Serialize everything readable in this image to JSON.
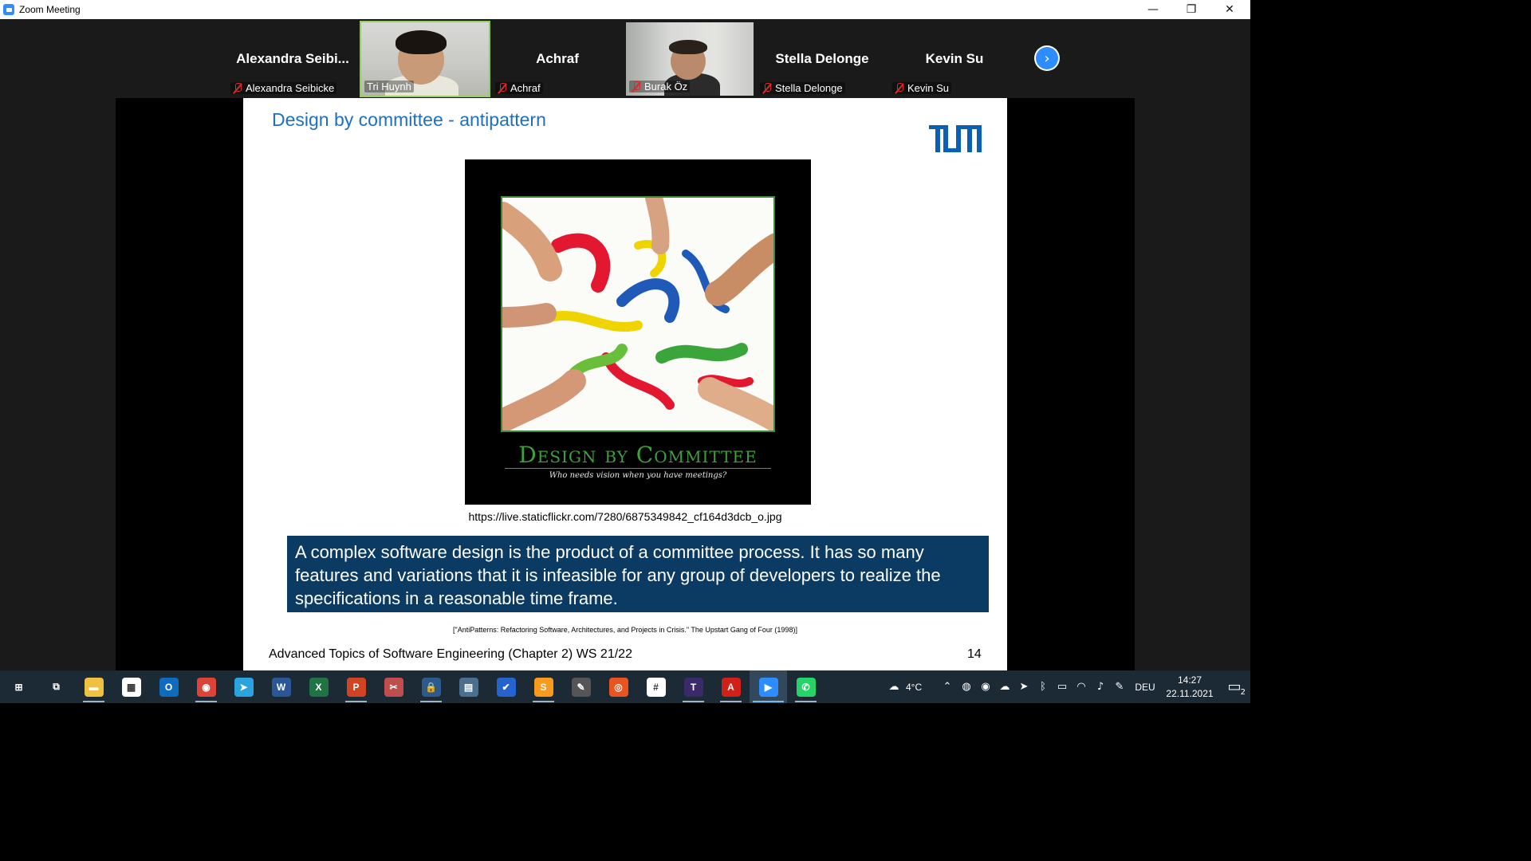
{
  "window": {
    "title": "Zoom Meeting",
    "minimize": "—",
    "restore": "❐",
    "close": "✕"
  },
  "participants": [
    {
      "big_name": "Alexandra  Seibi...",
      "label": "Alexandra Seibicke",
      "video": false,
      "muted": true
    },
    {
      "big_name": "",
      "label": "Tri Huynh",
      "video": true,
      "muted": false,
      "active_speaker": true
    },
    {
      "big_name": "Achraf",
      "label": "Achraf",
      "video": false,
      "muted": true
    },
    {
      "big_name": "",
      "label": "Burak Öz",
      "video": true,
      "muted": true
    },
    {
      "big_name": "Stella Delonge",
      "label": "Stella Delonge",
      "video": false,
      "muted": true
    },
    {
      "big_name": "Kevin Su",
      "label": "Kevin Su",
      "video": false,
      "muted": true
    }
  ],
  "strip_next_icon": "chevron-right-icon",
  "slide": {
    "title": "Design by committee - antipattern",
    "logo_text": "TUM",
    "poster_title": "Design by Committee",
    "poster_subtitle": "Who needs vision when you have meetings?",
    "image_source": "https://live.staticflickr.com/7280/6875349842_cf164d3dcb_o.jpg",
    "quote": "A complex software design is the product of a committee process. It has so many features and variations that it is infeasible for any group of developers to realize the specifications in a reasonable time frame.",
    "citation": "[\"AntiPatterns: Refactoring Software, Architectures, and Projects in Crisis.\" The Upstart Gang of Four (1998)]",
    "footer": "Advanced Topics of Software Engineering (Chapter 2) WS 21/22",
    "page_number": "14"
  },
  "taskbar": {
    "apps": [
      {
        "name": "start-button",
        "glyph": "⊞",
        "color": "transparent",
        "running": false
      },
      {
        "name": "task-view-button",
        "glyph": "⧉",
        "color": "transparent",
        "running": false
      },
      {
        "name": "file-explorer",
        "glyph": "▬",
        "color": "#f0c040",
        "running": true
      },
      {
        "name": "microsoft-store",
        "glyph": "▦",
        "color": "#ffffff",
        "running": false
      },
      {
        "name": "outlook",
        "glyph": "O",
        "color": "#0f6cbd",
        "running": false
      },
      {
        "name": "chrome",
        "glyph": "◉",
        "color": "#db4437",
        "running": true
      },
      {
        "name": "telegram",
        "glyph": "➤",
        "color": "#2aa3df",
        "running": false
      },
      {
        "name": "word",
        "glyph": "W",
        "color": "#2b5797",
        "running": false
      },
      {
        "name": "excel",
        "glyph": "X",
        "color": "#217346",
        "running": false
      },
      {
        "name": "powerpoint",
        "glyph": "P",
        "color": "#d04423",
        "running": true
      },
      {
        "name": "snipping-tool",
        "glyph": "✂",
        "color": "#c04e4e",
        "running": false
      },
      {
        "name": "keepass",
        "glyph": "🔒",
        "color": "#2c5a8a",
        "running": true
      },
      {
        "name": "calculator",
        "glyph": "▤",
        "color": "#4b6f8f",
        "running": false
      },
      {
        "name": "todo",
        "glyph": "✔",
        "color": "#2564cf",
        "running": false
      },
      {
        "name": "sublime-text",
        "glyph": "S",
        "color": "#f79a1e",
        "running": true
      },
      {
        "name": "inkscape",
        "glyph": "✎",
        "color": "#555555",
        "running": false
      },
      {
        "name": "ubuntu",
        "glyph": "◎",
        "color": "#e95420",
        "running": false
      },
      {
        "name": "slack",
        "glyph": "#",
        "color": "#ffffff",
        "running": false
      },
      {
        "name": "texstudio",
        "glyph": "T",
        "color": "#3a2a6a",
        "running": true
      },
      {
        "name": "acrobat",
        "glyph": "A",
        "color": "#d0201a",
        "running": true
      },
      {
        "name": "zoom",
        "glyph": "▶",
        "color": "#2d8cff",
        "running": true,
        "focused": true
      },
      {
        "name": "whatsapp",
        "glyph": "✆",
        "color": "#25d366",
        "running": true
      }
    ],
    "weather": "4°C",
    "language": "DEU",
    "time": "14:27",
    "date": "22.11.2021",
    "notifications": "2"
  }
}
